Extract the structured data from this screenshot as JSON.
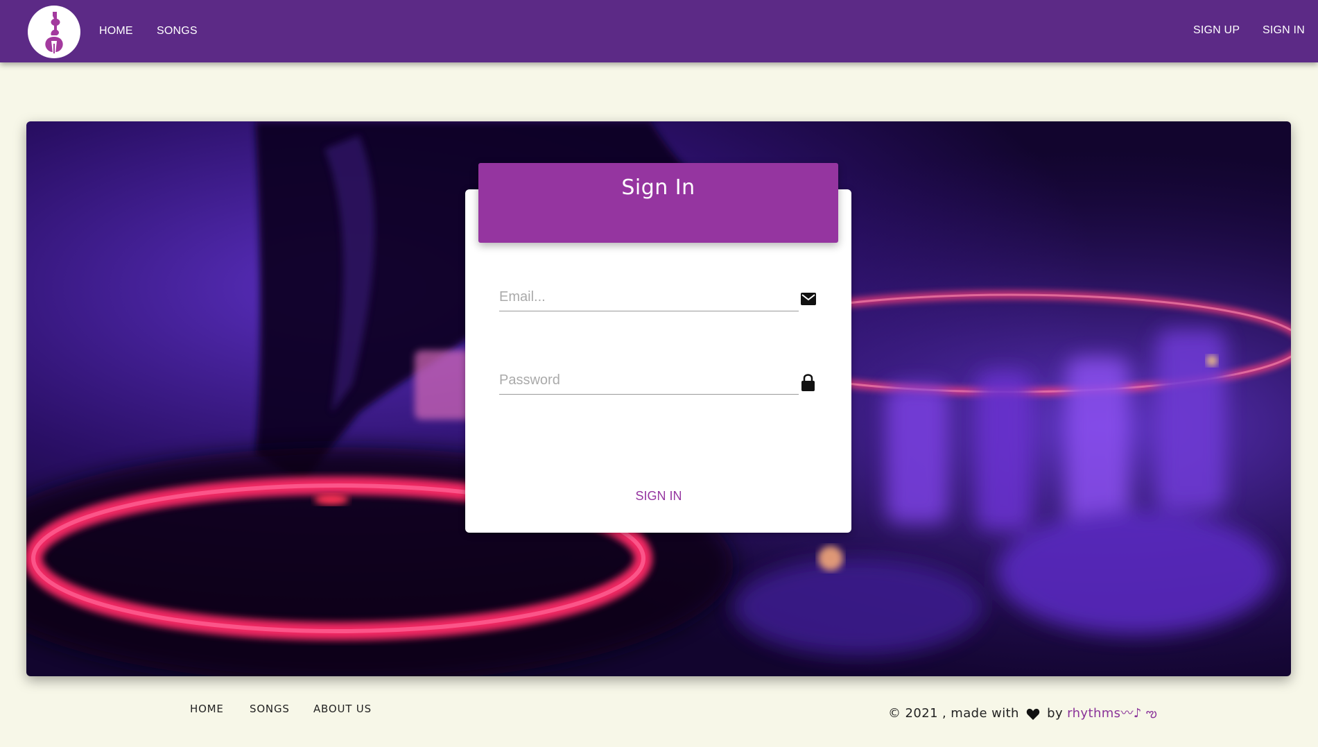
{
  "navbar": {
    "logo_icon": "guitar-music-logo-icon",
    "home_label": "HOME",
    "songs_label": "SONGS",
    "signup_label": "SIGN UP",
    "signin_label": "SIGN IN",
    "background_color": "#5c2a86"
  },
  "form": {
    "title": "Sign In",
    "email_placeholder": "Email...",
    "password_placeholder": "Password",
    "submit_label": "SIGN IN",
    "email_icon": "envelope-icon",
    "password_icon": "lock-icon",
    "accent_color": "#9535a0"
  },
  "footer": {
    "links": [
      "HOME",
      "SONGS",
      "ABOUT US"
    ],
    "copyright_prefix": "© 2021 , made with",
    "by_text": "by",
    "brand": "rhythms",
    "brand_suffix": "〰♪ ఌ",
    "heart_icon": "heart-icon"
  },
  "colors": {
    "page_background": "#f7f7e8",
    "brand_link": "#8a3399"
  }
}
